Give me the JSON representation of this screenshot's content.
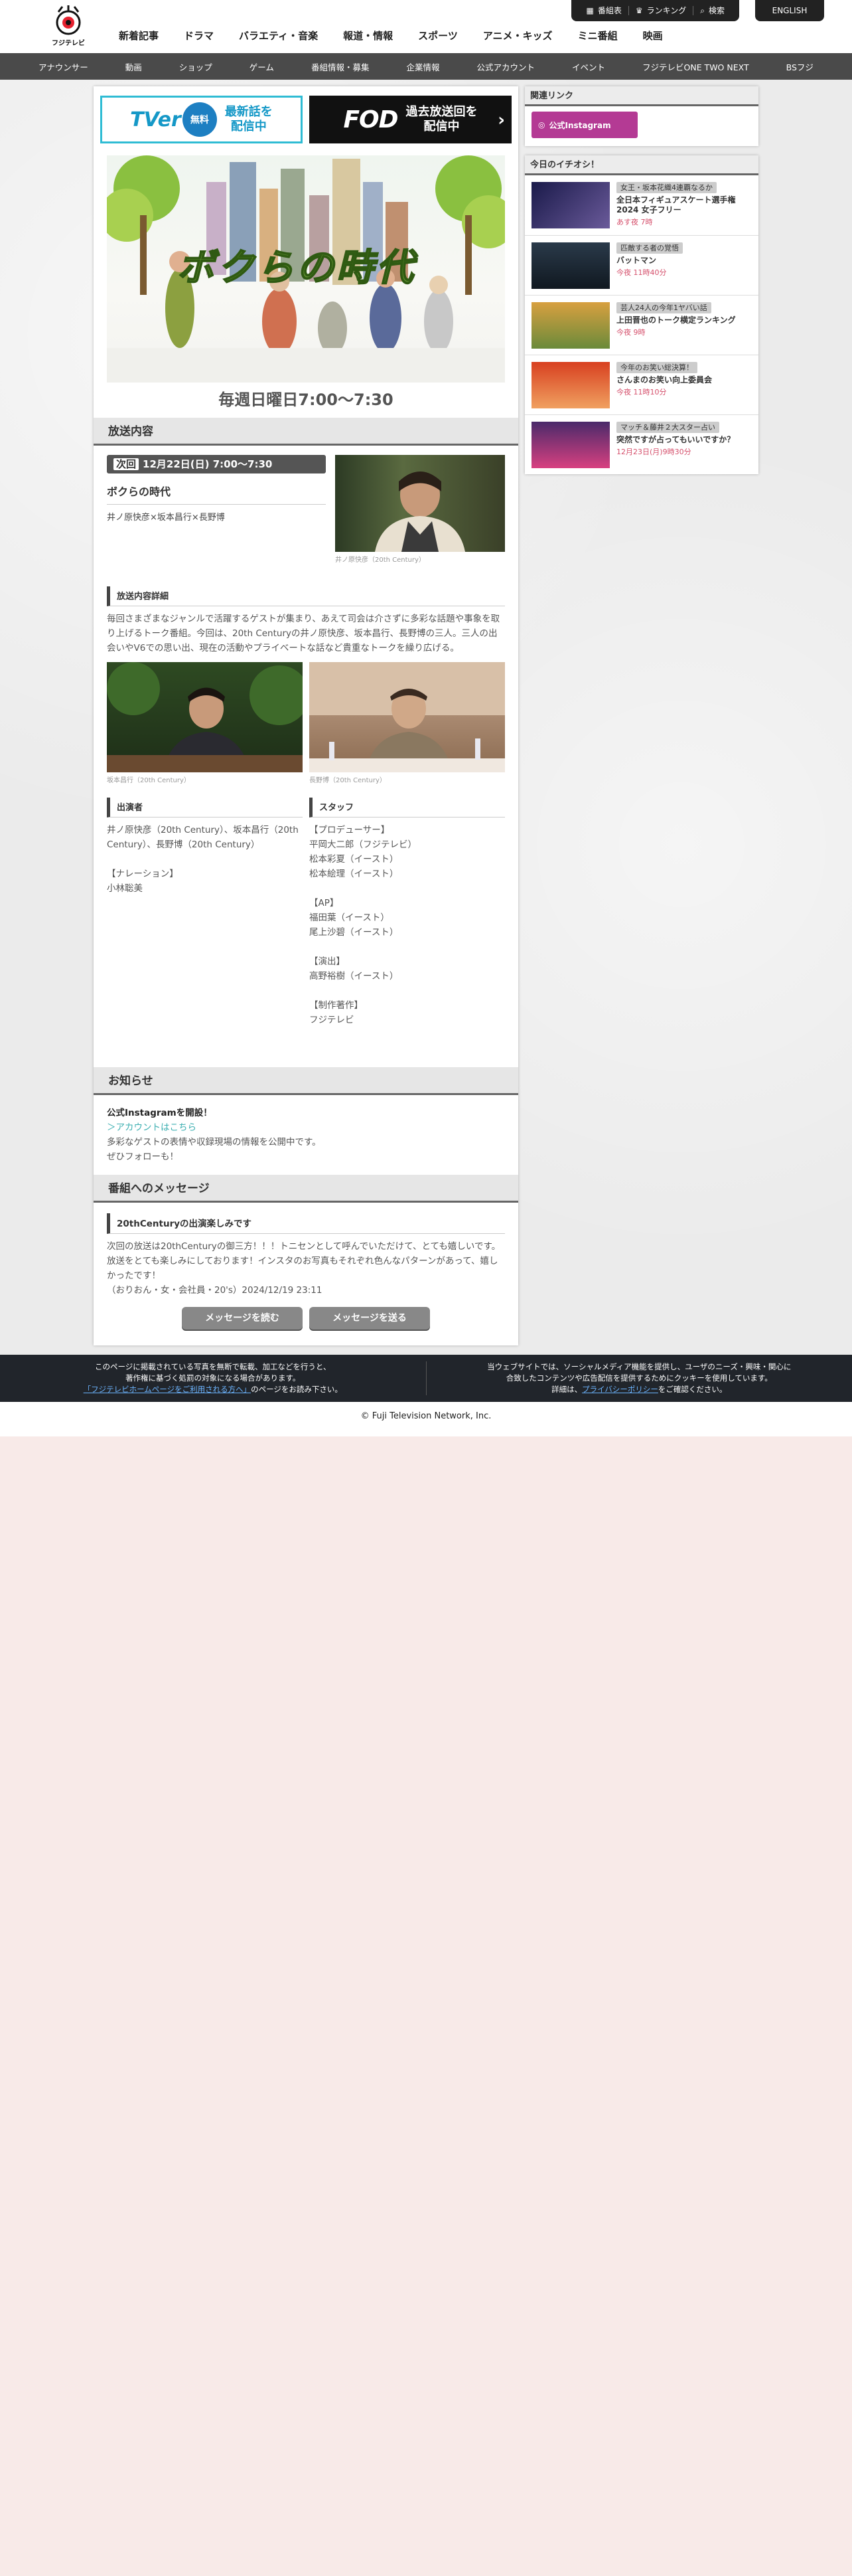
{
  "header": {
    "logo_text": "フジテレビ",
    "main_nav": [
      "新着記事",
      "ドラマ",
      "バラエティ・音楽",
      "報道・情報",
      "スポーツ",
      "アニメ・キッズ",
      "ミニ番組",
      "映画"
    ],
    "util": {
      "schedule": "番組表",
      "ranking": "ランキング",
      "search": "検索"
    },
    "english": "ENGLISH"
  },
  "sub_nav": [
    "アナウンサー",
    "動画",
    "ショップ",
    "ゲーム",
    "番組情報・募集",
    "企業情報",
    "公式アカウント",
    "イベント",
    "フジテレビONE TWO NEXT",
    "BSフジ"
  ],
  "banners": {
    "tver_logo": "TVer",
    "tver_free": "無料",
    "tver_text_1": "最新話を",
    "tver_text_2": "配信中",
    "fod_logo": "FOD",
    "fod_text_1": "過去放送回を",
    "fod_text_2": "配信中"
  },
  "hero": {
    "title": "ボクらの時代",
    "airtime": "毎週日曜日7:00〜7:30"
  },
  "broadcast": {
    "heading": "放送内容",
    "date_tag": "次回",
    "date": "12月22日(日) 7:00〜7:30",
    "title": "ボクらの時代",
    "cast": "井ノ原快彦×坂本昌行×長野博",
    "photo_caption": "井ノ原快彦（20th Century）",
    "detail_heading": "放送内容詳細",
    "detail_text": "毎回さまざまなジャンルで活躍するゲストが集まり、あえて司会は介さずに多彩な話題や事象を取り上げるトーク番組。今回は、20th Centuryの井ノ原快彦、坂本昌行、長野博の三人。三人の出会いやV6での思い出、現在の活動やプライベートな話など貴重なトークを繰り広げる。",
    "caption_left": "坂本昌行（20th Century）",
    "caption_right": "長野博（20th Century）",
    "cast_heading": "出演者",
    "cast_body": "井ノ原快彦（20th Century）、坂本昌行（20th Century）、長野博（20th Century）\n\n【ナレーション】\n小林聡美",
    "staff_heading": "スタッフ",
    "staff_body": "【プロデューサー】\n平岡大二郎（フジテレビ）\n松本彩夏（イースト）\n松本絵理（イースト）\n\n【AP】\n福田葉（イースト）\n尾上沙碧（イースト）\n\n【演出】\n高野裕樹（イースト）\n\n【制作著作】\nフジテレビ"
  },
  "news": {
    "heading": "お知らせ",
    "title": "公式Instagramを開設！",
    "link": "＞アカウントはこちら",
    "line1": "多彩なゲストの表情や収録現場の情報を公開中です。",
    "line2": "ぜひフォローも！"
  },
  "messages": {
    "heading": "番組へのメッセージ",
    "title": "20thCenturyの出演楽しみです",
    "body": "次回の放送は20thCenturyの御三方！！！トニセンとして呼んでいただけて、とても嬉しいです。放送をとても楽しみにしております！インスタのお写真もそれぞれ色んなパターンがあって、嬉しかったです！",
    "author": "（おりおん・女・会社員・20's）2024/12/19 23:11",
    "read_btn": "メッセージを読む",
    "send_btn": "メッセージを送る"
  },
  "sidebar": {
    "related_heading": "関連リンク",
    "instagram": "公式Instagram",
    "pickup_heading": "今日のイチオシ！",
    "picks": [
      {
        "tag": "女王・坂本花織4連覇なるか",
        "title": "全日本フィギュアスケート選手権2024 女子フリー",
        "time": "あす夜 7時"
      },
      {
        "tag": "匹敵する者の覚悟",
        "title": "バットマン",
        "time": "今夜 11時40分"
      },
      {
        "tag": "芸人24人の今年1ヤバい話",
        "title": "上田晋也のトーク横定ランキング",
        "time": "今夜 9時"
      },
      {
        "tag": "今年のお笑い総決算！",
        "title": "さんまのお笑い向上委員会",
        "time": "今夜 11時10分"
      },
      {
        "tag": "マッチ＆藤井２大スター占い",
        "title": "突然ですが占ってもいいですか？",
        "time": "12月23日(月)9時30分"
      }
    ]
  },
  "footer": {
    "left_1": "このページに掲載されている写真を無断で転載、加工などを行うと、",
    "left_2": "著作権に基づく処罰の対象になる場合があります。",
    "left_link": "「フジテレビホームページをご利用される方へ」",
    "left_3": "のページをお読み下さい。",
    "right_1": "当ウェブサイトでは、ソーシャルメディア機能を提供し、ユーザのニーズ・興味・関心に",
    "right_2": "合致したコンテンツや広告配信を提供するためにクッキーを使用しています。",
    "right_3a": "詳細は、",
    "right_link": "プライバシーポリシー",
    "right_3b": "をご確認ください。",
    "copyright": "© Fuji Television Network, Inc."
  }
}
